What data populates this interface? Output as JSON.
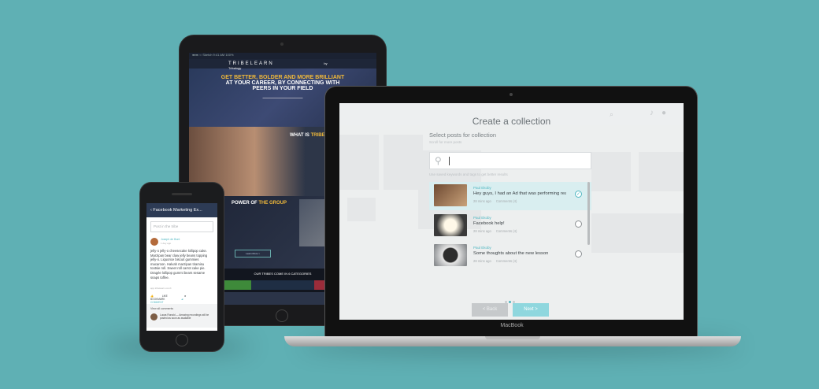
{
  "tablet": {
    "status": "●●●○○ Sketch  9:41 AM  100%",
    "brand": "TRIBELEARN",
    "brand_right": "by Tribalogy",
    "hero_line1": "GET BETTER, BOLDER AND MORE BRILLIANT",
    "hero_line2": "AT YOUR CAREER, BY CONNECTING WITH",
    "hero_line3": "PEERS IN YOUR FIELD",
    "section_what": "WHAT IS",
    "section_what_accent": "TRIBELE",
    "section_power": "POWER OF",
    "section_power_accent": "THE GROUP",
    "learn_more": "Learn More >",
    "tribes": "OUR TRIBES COME IN 6 CATEGORIES"
  },
  "laptop": {
    "label": "MacBook",
    "modal_title": "Create a collection",
    "subtitle": "Select posts for collection",
    "hint": "Scroll for more posts",
    "search_hint": "Use saved keywords and tags to get better results",
    "posts": [
      {
        "author": "Paul Ekoby",
        "title": "Hey guys, I had an Ad that was performing really wel...",
        "time": "28 mins ago",
        "comments": "Comments (4)",
        "selected": true
      },
      {
        "author": "Paul Ekoby",
        "title": "Facebook help!",
        "time": "28 mins ago",
        "comments": "Comments (4)",
        "selected": false
      },
      {
        "author": "Paul Ekoby",
        "title": "Some thoughts about the new lesson",
        "time": "28 mins ago",
        "comments": "Comments (4)",
        "selected": false
      }
    ],
    "back_label": "< Back",
    "next_label": "Next >",
    "accent": "#4fb6c1"
  },
  "phone": {
    "header": "Facebook Marketing Ex...",
    "input_placeholder": "Post in the tribe",
    "author": "Joseph de Bont",
    "time": "1 day ago",
    "body": "jelly-o jelly-o cheesecake lollipop cake. Marzipan bear claw jelly beans topping jelly-o. Liquorice biscuit gummies macaroon. Halvah marzipan tiramisu tootsie roll. Sweet roll carrot cake pie. Dragée lollipop gummi bears sesame snaps toffee.",
    "link": "app.tribelearn.com/t",
    "like": "LIKE",
    "bookmark": "BOOKMARK",
    "comment": "COMMENT",
    "view_all": "View all comments",
    "comment_text": "Lucas Ronald — Amazing recordings will be posted as soon as available"
  }
}
